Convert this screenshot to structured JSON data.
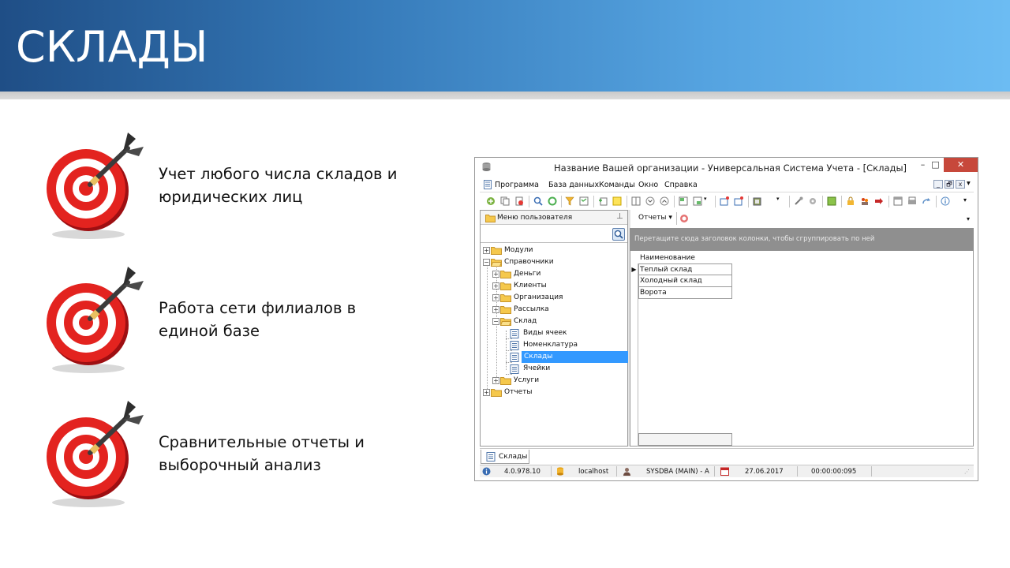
{
  "slide": {
    "title": "СКЛАДЫ",
    "bullets": [
      {
        "text": "Учет любого числа складов и юридических лиц",
        "icon": "target-dart-icon"
      },
      {
        "text": "Работа сети филиалов в единой базе",
        "icon": "target-dart-icon"
      },
      {
        "text": "Сравнительные отчеты и выборочный анализ",
        "icon": "target-dart-icon"
      }
    ]
  },
  "app": {
    "window_title": "Название Вашей организации - Универсальная Система Учета - [Склады]",
    "window_controls": {
      "minimize": "–",
      "maximize": "□",
      "close": "✕"
    },
    "menu": [
      "Программа",
      "База данных",
      "Команды",
      "Окно",
      "Справка"
    ],
    "mdi_controls": [
      "_",
      "🗗",
      "x"
    ],
    "left_panel": {
      "title": "Меню пользователя",
      "tree": [
        {
          "label": "Модули",
          "expander": "+"
        },
        {
          "label": "Справочники",
          "expander": "−"
        },
        {
          "label": "Деньги",
          "expander": "+"
        },
        {
          "label": "Клиенты",
          "expander": "+"
        },
        {
          "label": "Организация",
          "expander": "+"
        },
        {
          "label": "Рассылка",
          "expander": "+"
        },
        {
          "label": "Склад",
          "expander": "−"
        },
        {
          "label": "Виды ячеек"
        },
        {
          "label": "Номенклатура"
        },
        {
          "label": "Склады",
          "selected": true
        },
        {
          "label": "Ячейки"
        },
        {
          "label": "Услуги",
          "expander": "+"
        },
        {
          "label": "Отчеты",
          "expander": "+"
        }
      ]
    },
    "right_panel": {
      "reports_button": "Отчеты ▾",
      "group_hint": "Перетащите сюда заголовок колонки, чтобы сгруппировать по ней",
      "column_header": "Наименование",
      "rows": [
        "Теплый склад",
        "Холодный склад",
        "Ворота"
      ],
      "current_row_marker": "▶"
    },
    "tab": "Склады",
    "status": {
      "version": "4.0.978.10",
      "host": "localhost",
      "user": "SYSDBA (MAIN) - A",
      "date": "27.06.2017",
      "time": "00:00:00:095"
    },
    "colors": {
      "header_start": "#1f4e86",
      "header_end": "#6cbcf3",
      "selection": "#3399ff",
      "close_button": "#c7483b",
      "group_panel": "#8f8f8f"
    }
  }
}
